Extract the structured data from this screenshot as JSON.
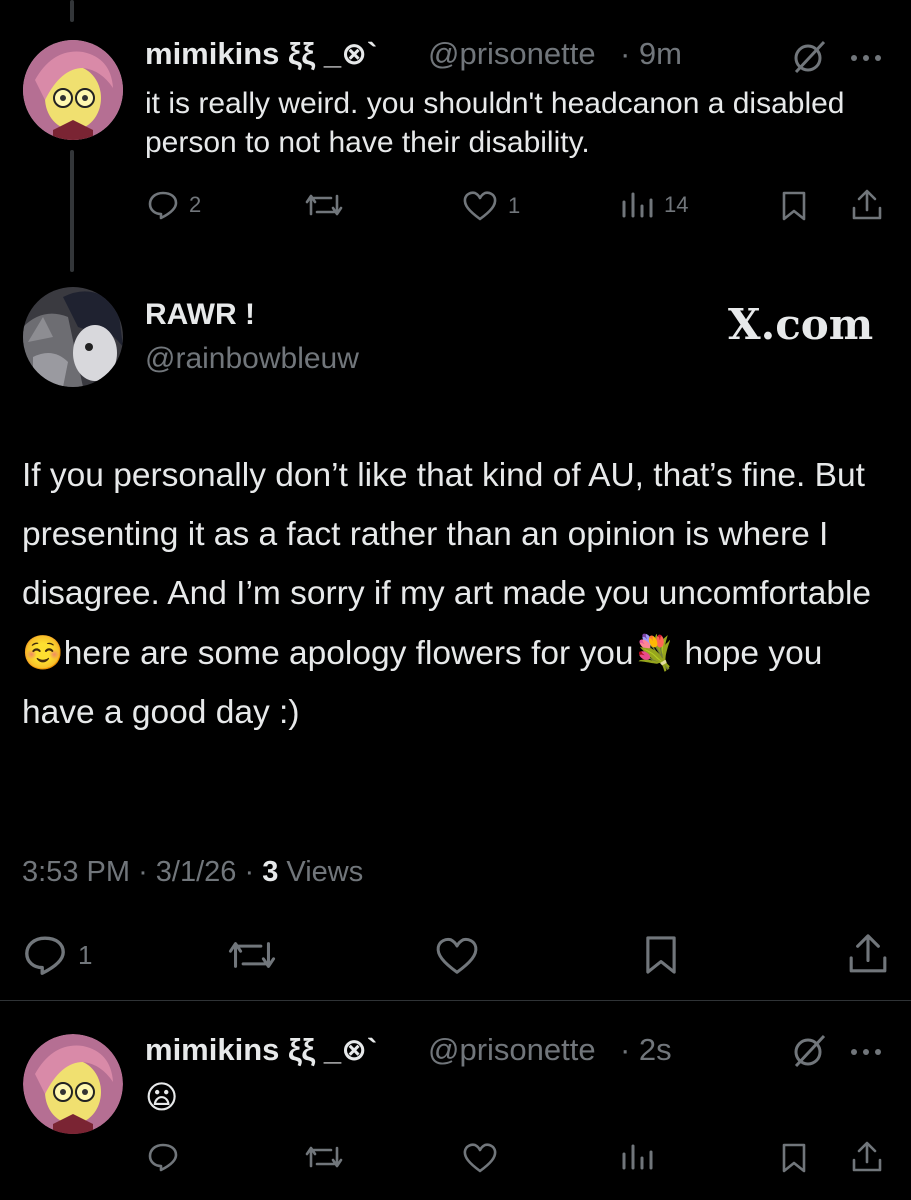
{
  "tweet1": {
    "name": "mimikins ξξ _⊗`",
    "handle": "@prisonette",
    "time": "· 9m",
    "text": "it is really weird. you shouldn't headcanon a disabled person to not have their disability.",
    "replies": "2",
    "likes": "1",
    "views": "14"
  },
  "main": {
    "name": "RAWR !",
    "handle": "@rainbowbleuw",
    "watermark": "X.com",
    "text_part1": "If you personally don’t like that kind of AU, that’s fine. But presenting it as a fact rather than an opinion is where I disagree. And I’m sorry if my art made you uncomfortable",
    "emoji1": "☺️",
    "text_part2": "here are some apology flowers for you",
    "emoji2": "💐",
    "text_part3": " hope you have a good day :)",
    "time": "3:53 PM",
    "date": "· 3/1/26 ·",
    "views_count": "3",
    "views_label": "Views",
    "replies": "1"
  },
  "tweet3": {
    "name": "mimikins ξξ _⊗`",
    "handle": "@prisonette",
    "time": "· 2s",
    "text": "😦"
  },
  "icons": {
    "reply": "reply-icon",
    "retweet": "retweet-icon",
    "like": "heart-icon",
    "views": "views-icon",
    "bookmark": "bookmark-icon",
    "share": "share-icon",
    "grok": "grok-icon",
    "more": "more-icon"
  },
  "colors": {
    "background": "#000000",
    "text": "#e7e9ea",
    "muted": "#71767b",
    "divider": "#2f3336"
  }
}
